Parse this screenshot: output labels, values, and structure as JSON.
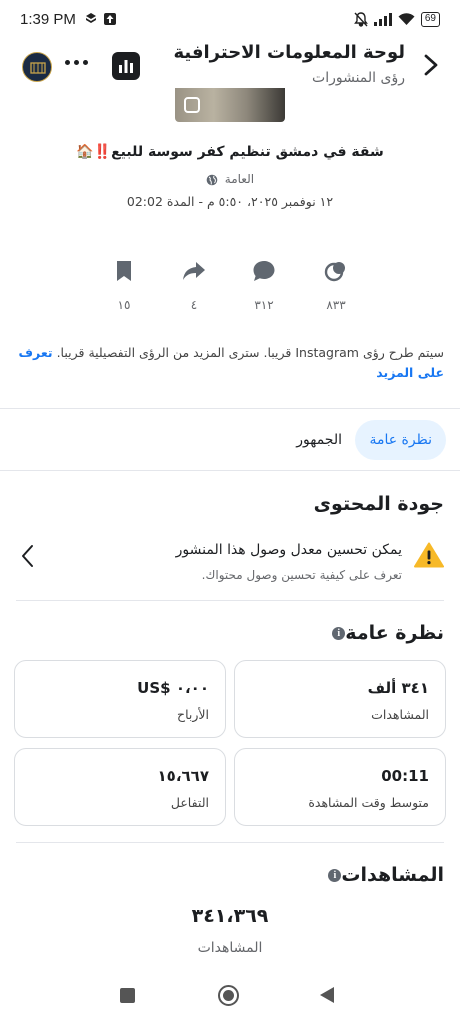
{
  "status_bar": {
    "time": "1:39 PM",
    "battery": "69"
  },
  "header": {
    "title": "لوحة المعلومات الاحترافية",
    "subtitle": "رؤى المنشورات"
  },
  "post": {
    "title": "شقة في دمشق تنظيم كفر سوسة للبيع‼️🏠",
    "audience": "العامة",
    "date": "١٢ نوفمبر ٢٠٢٥، ٥:٥٠ م - المدة 02:02"
  },
  "stats": {
    "views": "٨٣٣",
    "comments": "٣١٢",
    "shares": "٤",
    "saves": "١٥"
  },
  "notice": {
    "text": "سيتم طرح رؤى Instagram قريبا. سترى المزيد من الرؤى التفصيلية قريبا.",
    "link": "تعرف على المزيد"
  },
  "tabs": [
    "نظرة عامة",
    "الجمهور"
  ],
  "content_quality": {
    "title": "جودة المحتوى",
    "item_title": "يمكن تحسين معدل وصول هذا المنشور",
    "item_subtitle": "تعرف على كيفية تحسين وصول محتواك."
  },
  "overview": {
    "title": "نظرة عامة",
    "cards": [
      {
        "value": "٣٤١ ألف",
        "label": "المشاهدات"
      },
      {
        "value": "US$ ٠،٠٠",
        "label": "الأرباح"
      },
      {
        "value": "00:11",
        "label": "متوسط وقت المشاهدة"
      },
      {
        "value": "١٥،٦٦٧",
        "label": "التفاعل"
      }
    ]
  },
  "views_section": {
    "title": "المشاهدات",
    "value": "٣٤١،٣٦٩",
    "label": "المشاهدات"
  },
  "colors": {
    "accent": "#1877f2",
    "warning": "#f7b928"
  }
}
